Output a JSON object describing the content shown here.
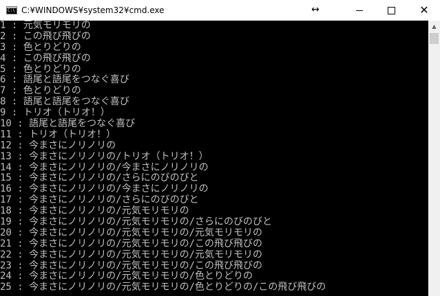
{
  "window": {
    "title": "C:¥WINDOWS¥system32¥cmd.exe",
    "icon_text": "C:\\",
    "resize_glyph": "↔"
  },
  "controls": {
    "minimize_icon": "minimize-icon",
    "maximize_icon": "maximize-icon",
    "close_glyph": "✕"
  },
  "console": {
    "lines": [
      "1 : 元気モリモリの",
      "2 : この飛び飛びの",
      "3 : 色とりどりの",
      "4 : この飛び飛びの",
      "5 : 色とりどりの",
      "6 : 語尾と語尾をつなぐ喜び",
      "7 : 色とりどりの",
      "8 : 語尾と語尾をつなぐ喜び",
      "9 : トリオ（トリオ！）",
      "10 : 語尾と語尾をつなぐ喜び",
      "11 : トリオ（トリオ！）",
      "12 : 今まさにノリノリの",
      "13 : 今まさにノリノリの/トリオ（トリオ！）",
      "14 : 今まさにノリノリの/今まさにノリノリの",
      "15 : 今まさにノリノリの/さらにのびのびと",
      "16 : 今まさにノリノリの/今まさにノリノリの",
      "17 : 今まさにノリノリの/さらにのびのびと",
      "18 : 今まさにノリノリの/元気モリモリの",
      "19 : 今まさにノリノリの/元気モリモリの/さらにのびのびと",
      "20 : 今まさにノリノリの/元気モリモリの/元気モリモリの",
      "21 : 今まさにノリノリの/元気モリモリの/この飛び飛びの",
      "22 : 今まさにノリノリの/元気モリモリの/元気モリモリの",
      "23 : 今まさにノリノリの/元気モリモリの/この飛び飛びの",
      "24 : 今まさにノリノリの/元気モリモリの/色とりどりの",
      "25 : 今まさにノリノリの/元気モリモリの/色とりどりの/この飛び飛びの"
    ]
  },
  "scrollbar": {
    "up_glyph": "▲"
  }
}
